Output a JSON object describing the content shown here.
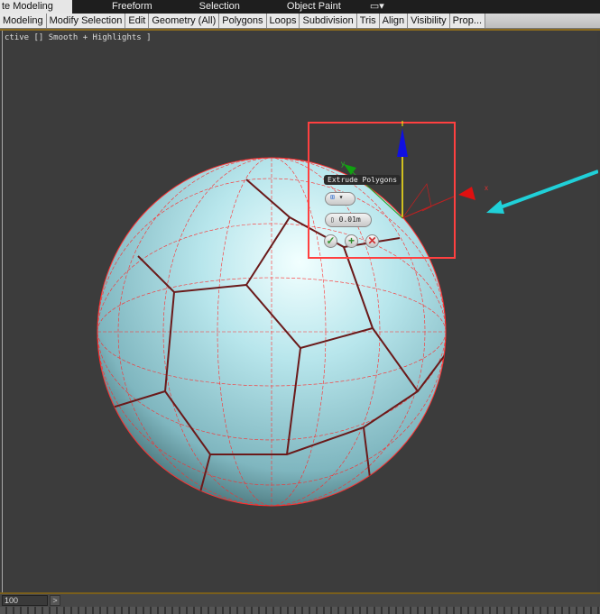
{
  "top_tabs": [
    "te Modeling Tools",
    "Freeform",
    "Selection",
    "Object Paint"
  ],
  "ribbon_tabs": [
    "Modeling",
    "Modify Selection",
    "Edit",
    "Geometry (All)",
    "Polygons",
    "Loops",
    "Subdivision",
    "Tris",
    "Align",
    "Visibility",
    "Prop..."
  ],
  "viewport_label": "ctive [] Smooth + Highlights ]",
  "caddy": {
    "title": "Extrude Polygons",
    "value": "0.01m",
    "ok_icon": "check-icon",
    "apply_icon": "plus-icon",
    "cancel_icon": "x-icon"
  },
  "timeline": {
    "frame": "100",
    "next": ">"
  },
  "colors": {
    "highlight_box": "#ff4040",
    "arrow": "#20d0d8",
    "wire": "#ff2020",
    "sphere": "#a8dce4"
  }
}
